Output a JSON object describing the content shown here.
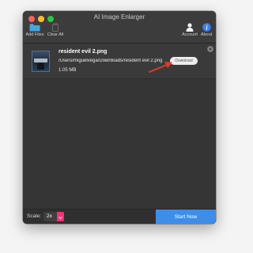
{
  "window": {
    "title": "AI Image Enlarger"
  },
  "toolbar": {
    "add_files": {
      "label": "Add Files",
      "icon": "folder-icon"
    },
    "clear_all": {
      "label": "Clear All",
      "icon": "trash-icon"
    },
    "account": {
      "label": "Account",
      "icon": "person-icon"
    },
    "about": {
      "label": "About",
      "icon": "info-icon"
    }
  },
  "files": [
    {
      "name": "resident evil 2.png",
      "path": "/Users/miguelvega/Downloads/resident evil 2.png",
      "size": "1.05 MB",
      "download_label": "Download"
    }
  ],
  "bottom": {
    "scale_label": "Scale:",
    "scale_value": "2x",
    "start_label": "Start Now"
  },
  "colors": {
    "accent_pink": "#ff2d72",
    "start_blue": "#3d8ee8",
    "info_blue": "#3d7ff0",
    "folder_blue": "#4aa3df",
    "arrow_red": "#e03a2a",
    "window_bg": "#353535"
  }
}
